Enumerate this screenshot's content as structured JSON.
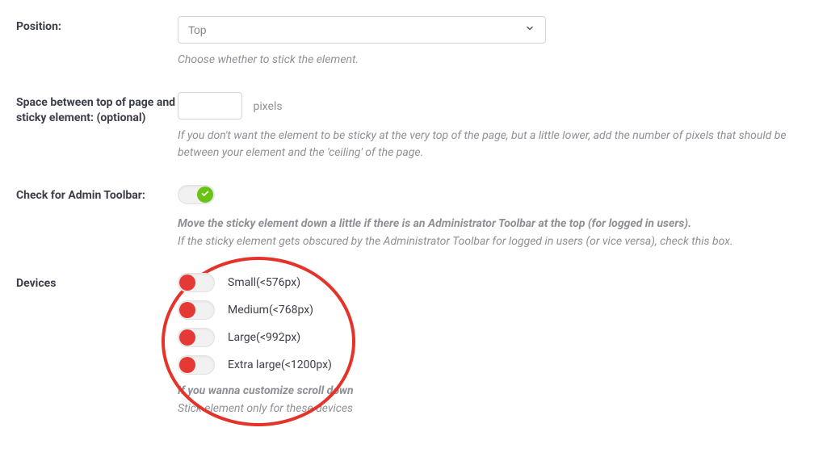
{
  "position": {
    "label": "Position:",
    "selected": "Top",
    "help": "Choose whether to stick the element."
  },
  "space": {
    "label": "Space between top of page and sticky element: (optional)",
    "value": "",
    "unit": "pixels",
    "help": "If you don't want the element to be sticky at the very top of the page, but a little lower, add the number of pixels that should be between your element and the 'ceiling' of the page."
  },
  "admin_toolbar": {
    "label": "Check for Admin Toolbar:",
    "help_bold": "Move the sticky element down a little if there is an Administrator Toolbar at the top (for logged in users).",
    "help": "If the sticky element gets obscured by the Administrator Toolbar for logged in users (or vice versa), check this box."
  },
  "devices": {
    "label": "Devices",
    "options": [
      {
        "label": "Small(<576px)"
      },
      {
        "label": "Medium(<768px)"
      },
      {
        "label": "Large(<992px)"
      },
      {
        "label": "Extra large(<1200px)"
      }
    ],
    "help_bold": "If you wanna customize scroll down",
    "help": "Stick element only for these devices"
  }
}
